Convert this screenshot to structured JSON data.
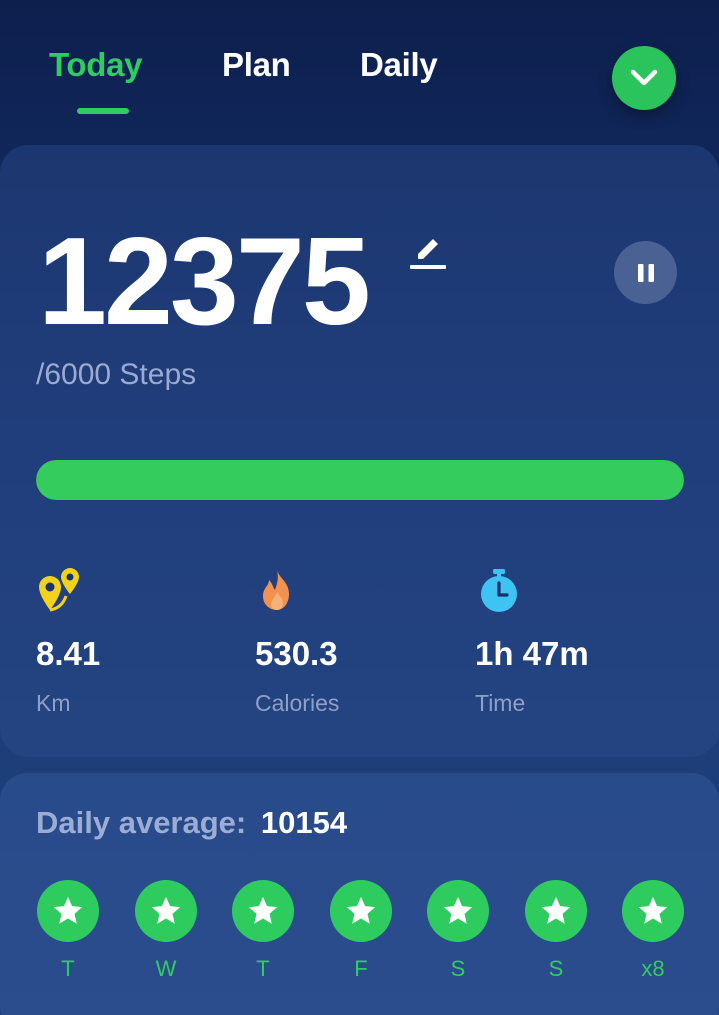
{
  "tabs": [
    {
      "label": "Today",
      "active": true
    },
    {
      "label": "Plan",
      "active": false
    },
    {
      "label": "Daily",
      "active": false
    }
  ],
  "header": {
    "dropdown_icon": "chevron-down-icon"
  },
  "steps": {
    "count": "12375",
    "goal_text": "/6000 Steps",
    "progress_percent": 100
  },
  "stats": [
    {
      "icon": "location-pins-icon",
      "value": "8.41",
      "label": "Km",
      "color": "#f2d21b"
    },
    {
      "icon": "flame-icon",
      "value": "530.3",
      "label": "Calories",
      "color": "#f3924f"
    },
    {
      "icon": "stopwatch-icon",
      "value": "1h 47m",
      "label": "Time",
      "color": "#3ec4f2"
    }
  ],
  "daily_average": {
    "label": "Daily average:",
    "value": "10154"
  },
  "days": [
    {
      "label": "T",
      "achieved": true
    },
    {
      "label": "W",
      "achieved": true
    },
    {
      "label": "T",
      "achieved": true
    },
    {
      "label": "F",
      "achieved": true
    },
    {
      "label": "S",
      "achieved": true
    },
    {
      "label": "S",
      "achieved": true
    },
    {
      "label": "x8",
      "achieved": true
    }
  ],
  "colors": {
    "accent": "#2fcc61",
    "progress": "#33cc5d"
  }
}
